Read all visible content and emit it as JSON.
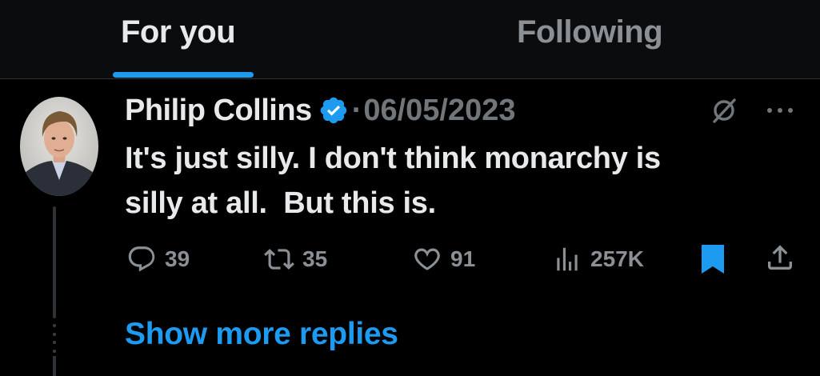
{
  "tabs": [
    {
      "label": "For you",
      "active": true
    },
    {
      "label": "Following",
      "active": false
    }
  ],
  "tweet": {
    "display_name": "Philip Collins",
    "separator": "·",
    "date": "06/05/2023",
    "text_lines": [
      "It's just silly. I don't think monarchy is",
      "silly at all.  But this is."
    ],
    "actions": {
      "replies": "39",
      "retweets": "35",
      "likes": "91",
      "views": "257K"
    },
    "icons": {
      "verified": "verified-badge-icon",
      "grok": "grok-icon",
      "more": "more-icon",
      "reply": "reply-icon",
      "retweet": "retweet-icon",
      "like": "heart-icon",
      "views": "views-icon",
      "bookmark": "bookmark-icon",
      "share": "share-icon"
    }
  },
  "show_more": "Show more replies",
  "colors": {
    "background": "#000000",
    "accent": "#1d9bf0",
    "text_primary": "#e7e9ea",
    "text_secondary": "#71767b"
  }
}
